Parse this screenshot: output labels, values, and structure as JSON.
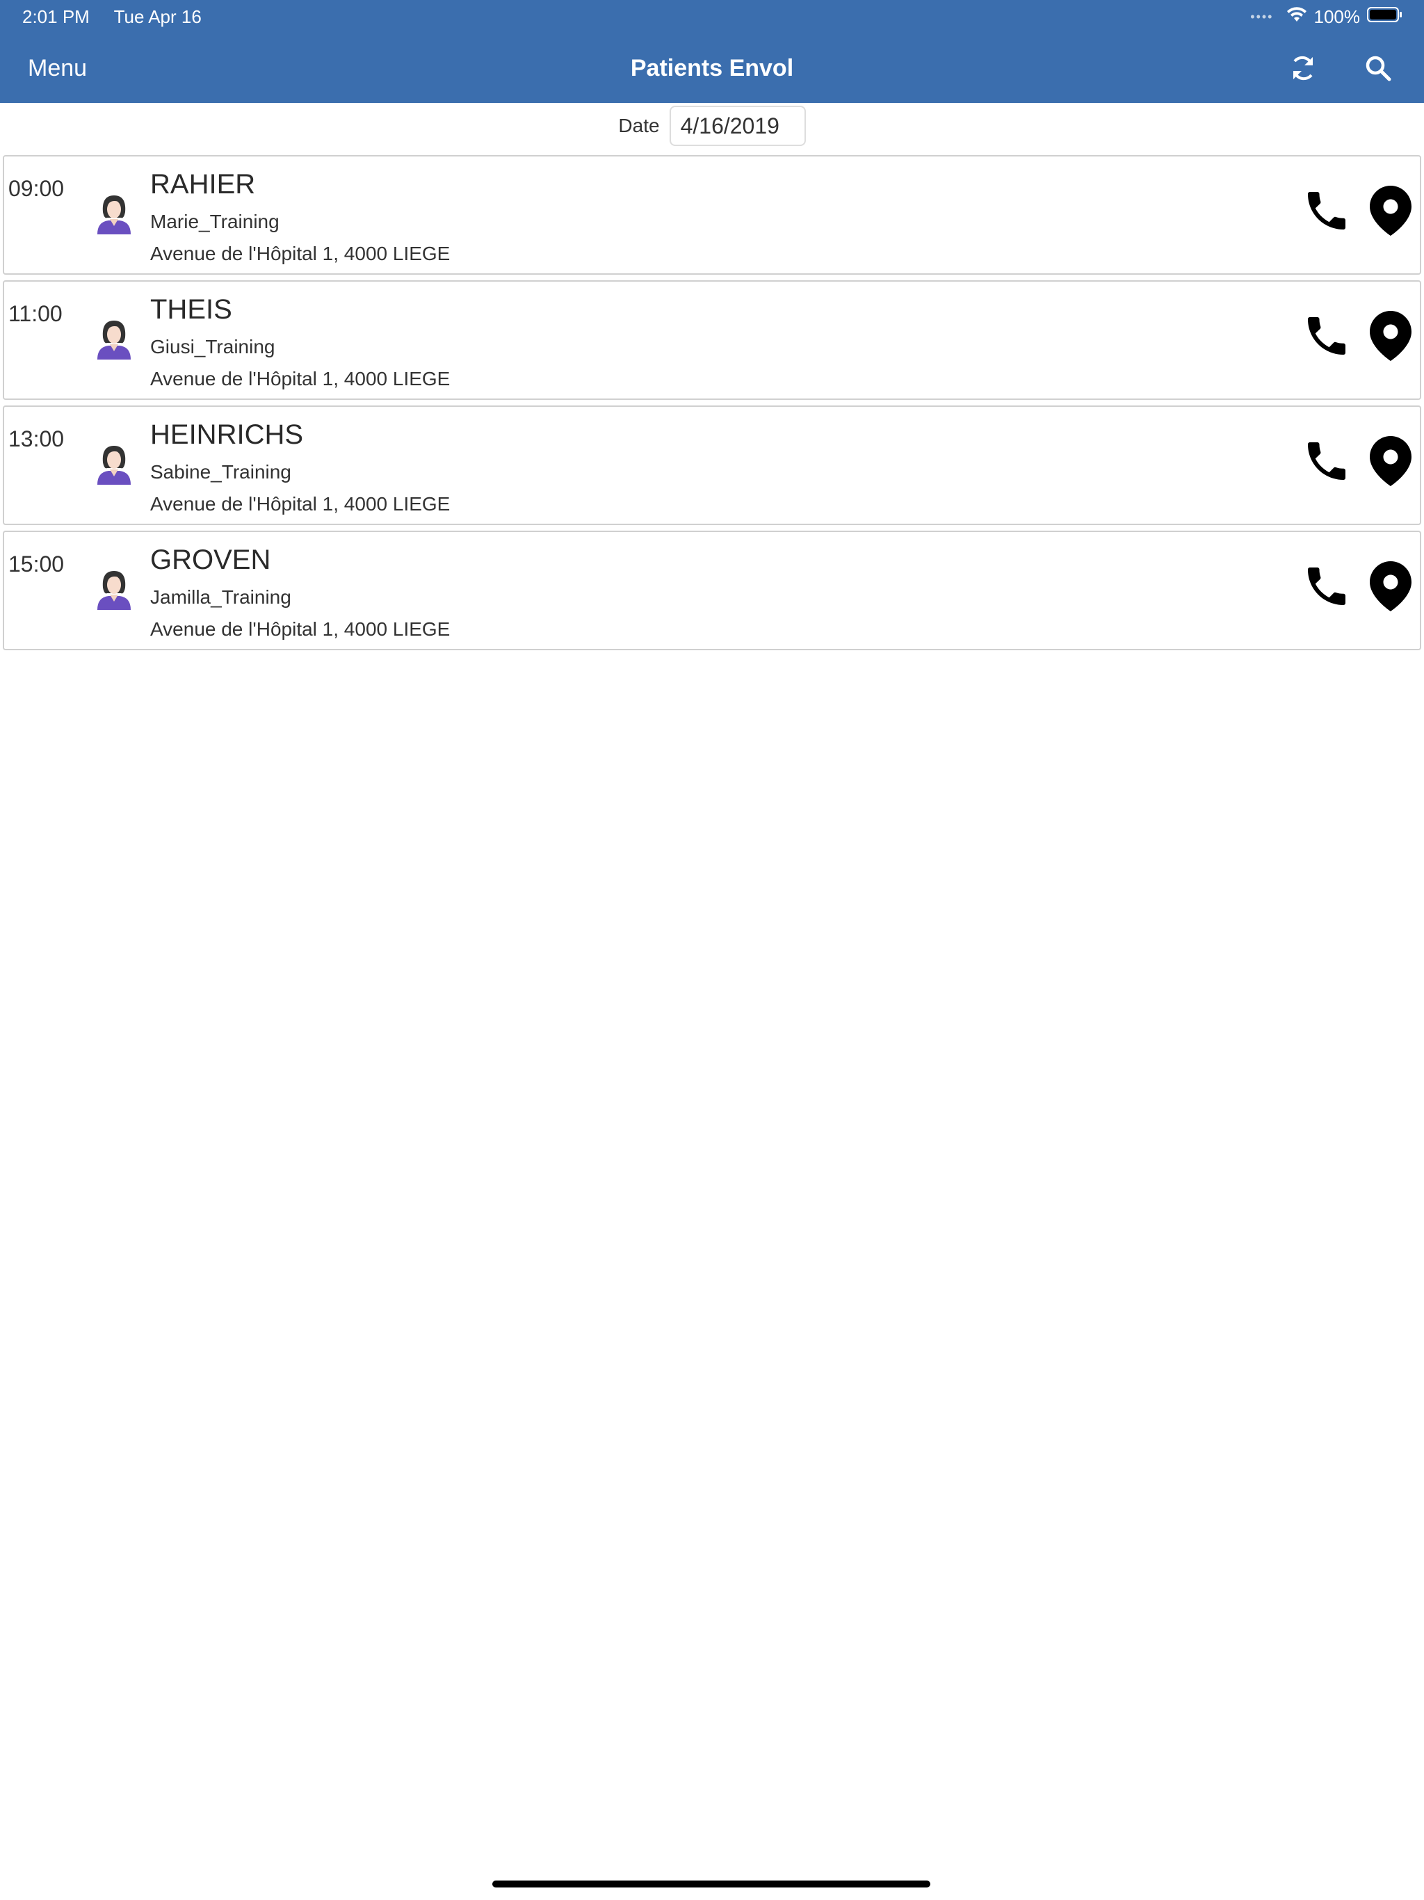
{
  "status_bar": {
    "time": "2:01 PM",
    "date": "Tue Apr 16",
    "battery": "100%"
  },
  "nav": {
    "menu_label": "Menu",
    "title": "Patients Envol",
    "refresh_icon": "refresh-icon",
    "search_icon": "search-icon"
  },
  "date_filter": {
    "label": "Date",
    "value": "4/16/2019"
  },
  "patients": [
    {
      "time": "09:00",
      "name": "RAHIER",
      "first_name": "Marie_Training",
      "address": "Avenue de l'Hôpital 1, 4000 LIEGE"
    },
    {
      "time": "11:00",
      "name": "THEIS",
      "first_name": "Giusi_Training",
      "address": "Avenue de l'Hôpital 1, 4000 LIEGE"
    },
    {
      "time": "13:00",
      "name": "HEINRICHS",
      "first_name": "Sabine_Training",
      "address": "Avenue de l'Hôpital 1, 4000 LIEGE"
    },
    {
      "time": "15:00",
      "name": "GROVEN",
      "first_name": "Jamilla_Training",
      "address": "Avenue de l'Hôpital 1, 4000 LIEGE"
    }
  ],
  "colors": {
    "header": "#3b6eae",
    "avatar_shirt": "#6a4fc0"
  }
}
